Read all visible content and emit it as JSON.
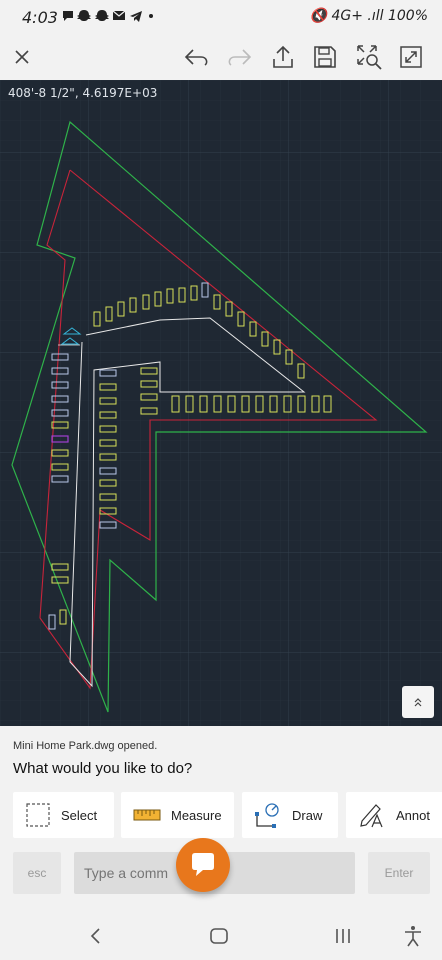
{
  "status_bar": {
    "time": "4:03",
    "notification_icons": [
      "message-icon",
      "snapchat-icon",
      "snapchat-icon",
      "mail-icon",
      "telegram-icon",
      "dot-icon"
    ],
    "right_text": "🔇 4G+ .ıll 100%",
    "battery_icon": "battery-icon"
  },
  "toolbar": {
    "close_icon": "close-icon",
    "undo_icon": "undo-icon",
    "redo_icon": "redo-icon",
    "share_icon": "share-icon",
    "save_icon": "save-icon",
    "zoom_extents_icon": "zoom-extents-icon",
    "fullscreen_icon": "fullscreen-icon"
  },
  "canvas": {
    "coordinate_readout": "408'-8 1/2\", 4.6197E+03",
    "colors": {
      "background": "#1f2833",
      "outer_boundary": "#2fb24a",
      "inner_boundary": "#c8243a",
      "road": "#e8e8e8",
      "lots": "#d7e05a",
      "units": "#b8c7e8",
      "marker": "#35b5d8",
      "highlight": "#a040d0"
    }
  },
  "panel": {
    "status_message": "Mini Home Park.dwg opened.",
    "prompt": "What would you like to do?",
    "tools": [
      {
        "label": "Select",
        "icon": "select-icon"
      },
      {
        "label": "Measure",
        "icon": "ruler-icon"
      },
      {
        "label": "Draw",
        "icon": "draw-icon"
      },
      {
        "label": "Annot",
        "icon": "annotate-icon"
      }
    ],
    "command_line": {
      "esc_label": "esc",
      "placeholder": "Type a comm",
      "enter_label": "Enter"
    },
    "fab_icon": "chat-icon"
  },
  "nav_bar": {
    "back_icon": "back-icon",
    "home_icon": "home-icon",
    "recents_icon": "recents-icon",
    "accessibility_icon": "accessibility-icon"
  }
}
